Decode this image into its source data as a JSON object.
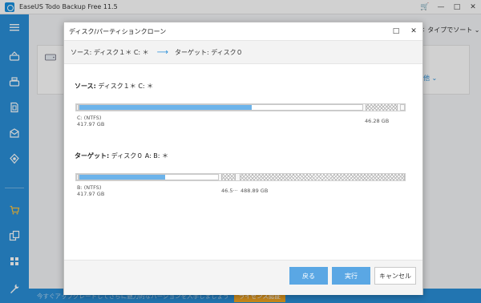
{
  "app": {
    "title": "EaseUS Todo Backup Free 11.5"
  },
  "window_controls": {
    "cart": "🛒",
    "minimize": "—",
    "restore": "□",
    "close": "✕"
  },
  "sidebar": {
    "items": [
      {
        "name": "menu"
      },
      {
        "name": "disk-backup"
      },
      {
        "name": "system-backup"
      },
      {
        "name": "file-backup"
      },
      {
        "name": "mail-backup"
      },
      {
        "name": "smart-backup"
      },
      {
        "name": "cart"
      },
      {
        "name": "clone"
      },
      {
        "name": "apps"
      },
      {
        "name": "tools"
      }
    ],
    "colors": {
      "bg": "#2a8fd8"
    }
  },
  "background": {
    "sort_label": "↕ タイプでソート ⌄",
    "other_button": "その他 ⌄"
  },
  "promo": {
    "text": "今すぐアップグレードしてさらに魅力的なバージョンを入手しましょう",
    "button": "ライセンス認証"
  },
  "dialog": {
    "title": "ディスク/パーティションクローン",
    "controls": {
      "maximize": "□",
      "close": "✕"
    },
    "route": {
      "source": "ソース:  ディスク１＊ C: ＊",
      "arrow": "⟶",
      "target": "ターゲット:  ディスク０"
    },
    "source_section": {
      "heading": "ソース:",
      "disk": "ディスク１＊ C: ＊",
      "partitions": [
        {
          "label": "C: (NTFS)",
          "size": "417.97 GB",
          "used_fraction": 0.61
        },
        {
          "label": "",
          "size": "46.28 GB"
        }
      ]
    },
    "target_section": {
      "heading": "ターゲット:",
      "disk": "ディスク０ A: B: ＊",
      "partitions": [
        {
          "label": "B: (NTFS)",
          "size": "417.97 GB",
          "used_fraction": 0.62
        },
        {
          "label": "",
          "size": "46.5···"
        },
        {
          "label": "",
          "size": "488.89 GB"
        }
      ]
    },
    "buttons": {
      "back": "戻る",
      "execute": "実行",
      "cancel": "キャンセル"
    }
  },
  "colors": {
    "accent": "#2a8fd8",
    "bar_fill": "#6cb3ea",
    "button_primary": "#5aa7e4",
    "promo_button": "#f5a623"
  }
}
